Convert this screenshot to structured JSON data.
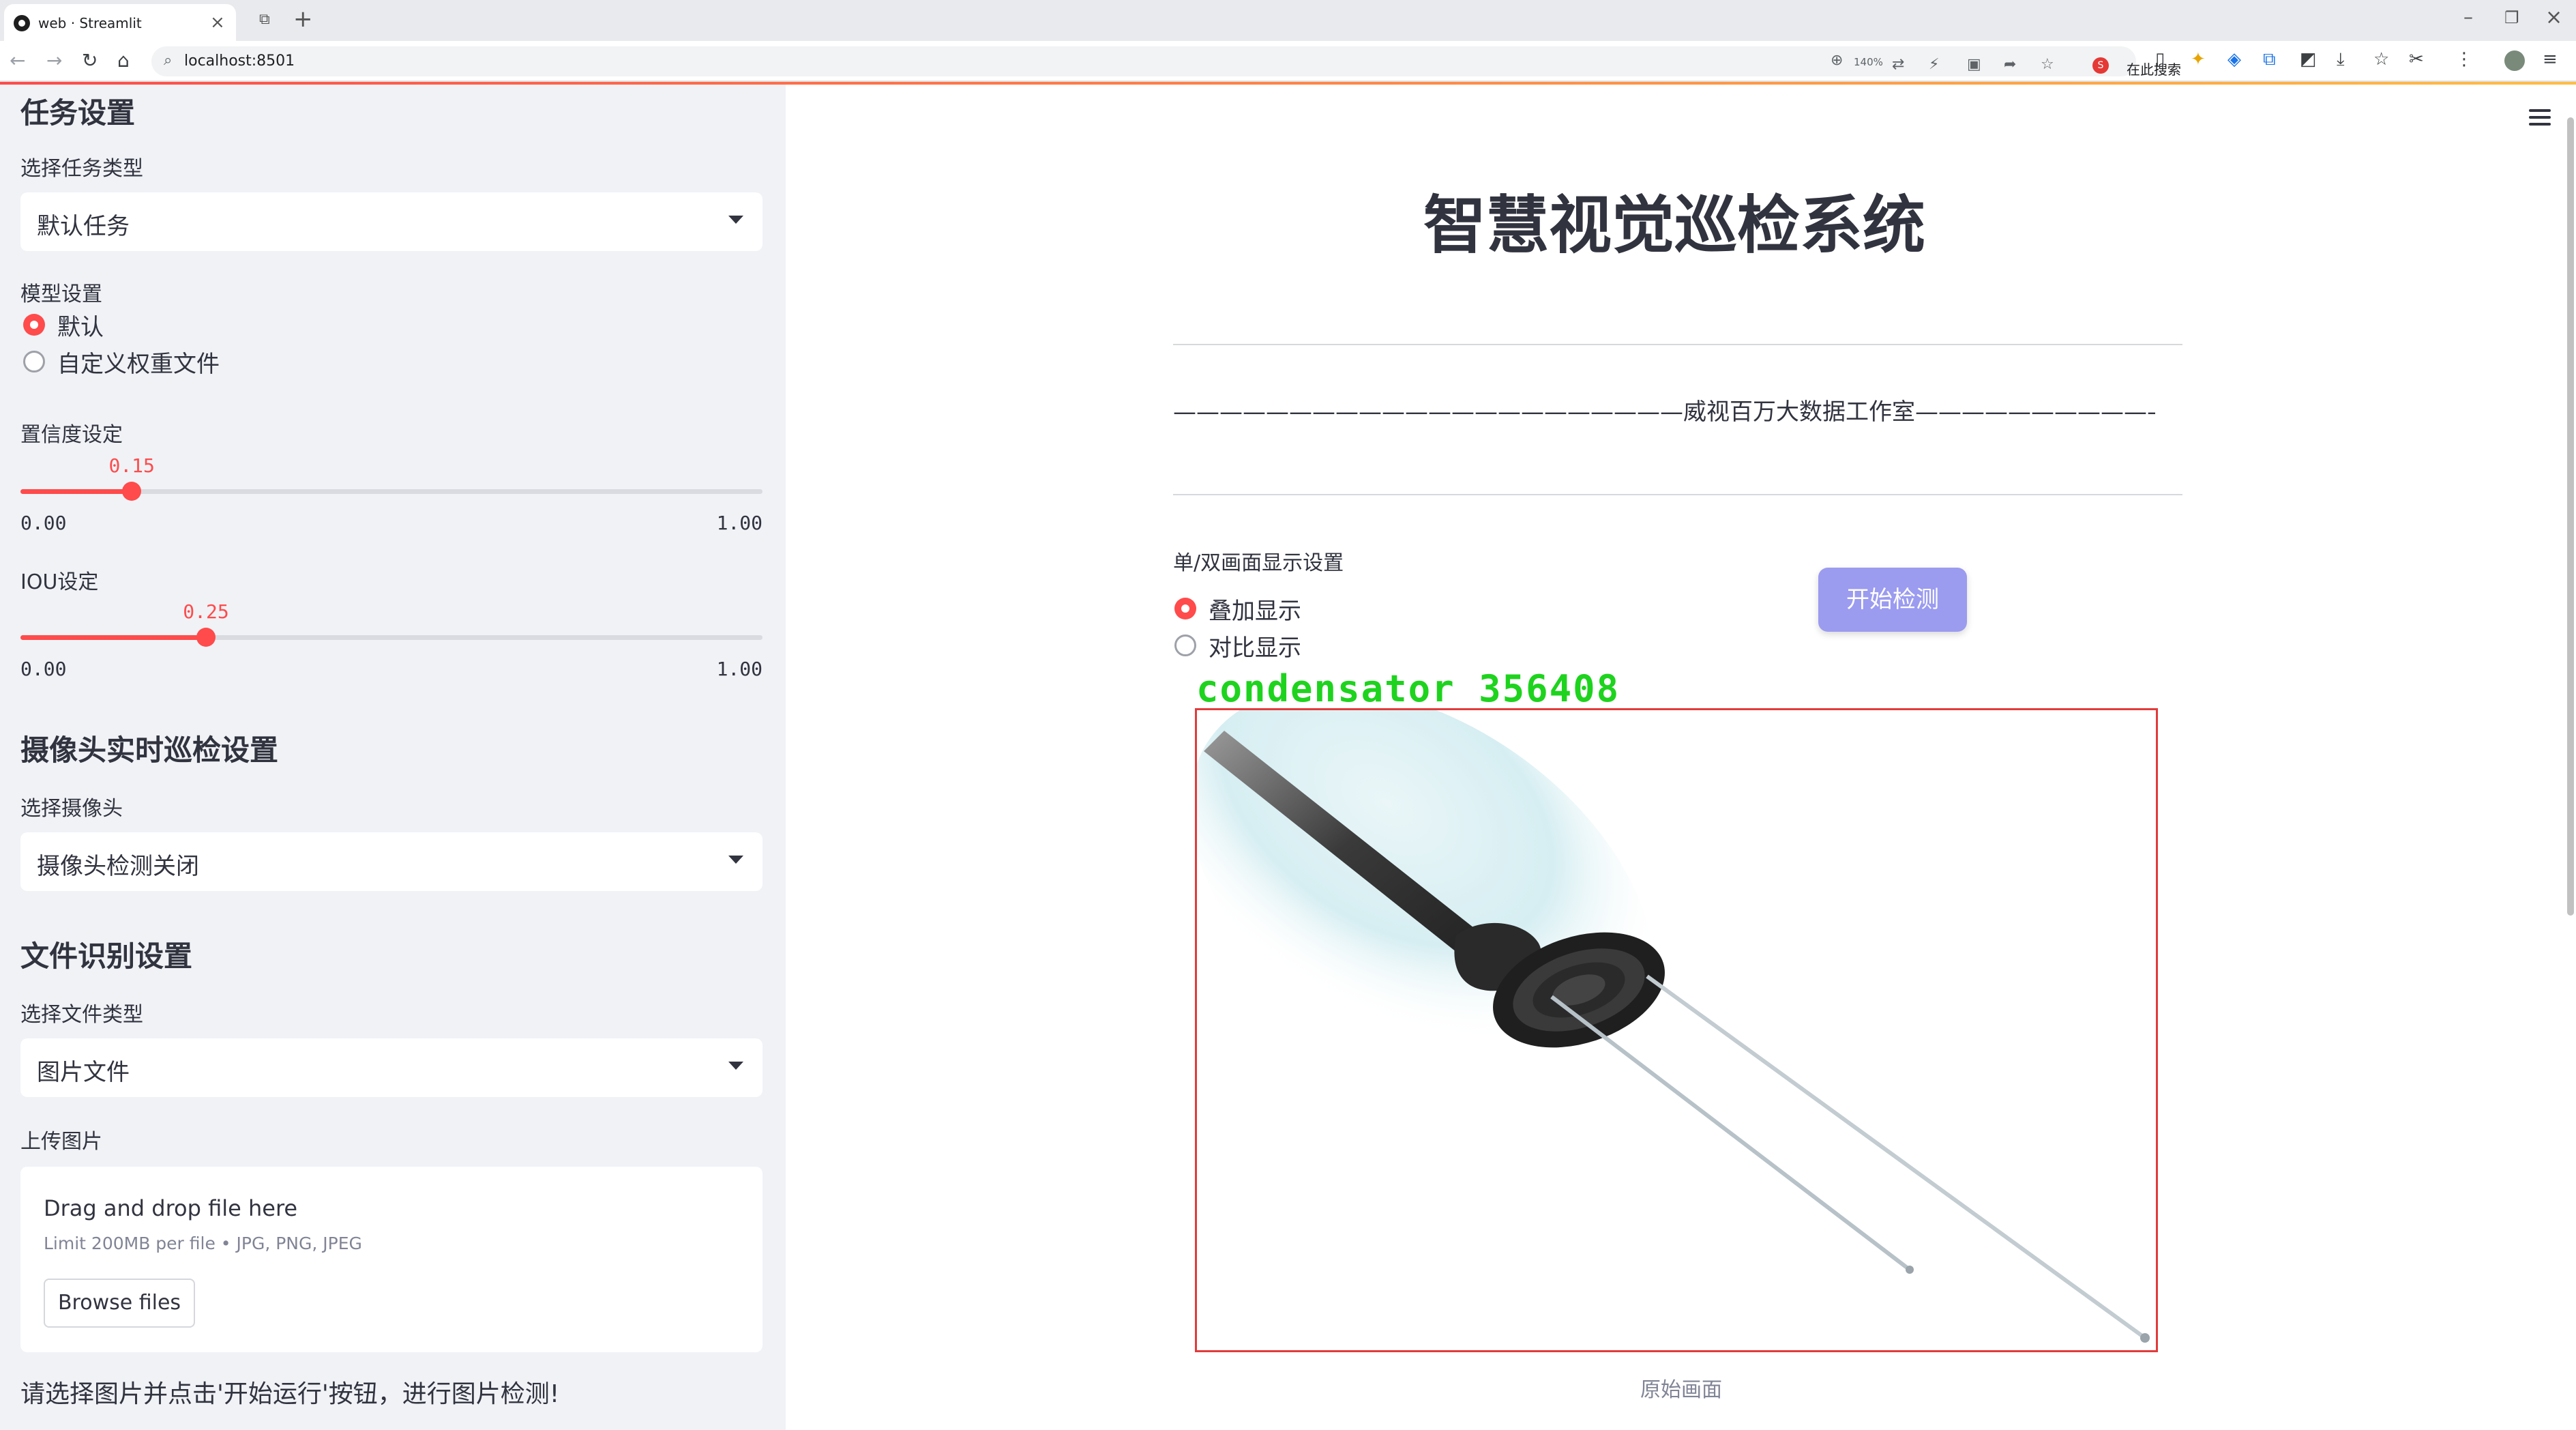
{
  "browser": {
    "tab_title": "web · Streamlit",
    "url": "localhost:8501",
    "zoom": "140%",
    "search_placeholder": "在此搜索"
  },
  "sidebar": {
    "task_header": "任务设置",
    "task_type_label": "选择任务类型",
    "task_type_value": "默认任务",
    "model_label": "模型设置",
    "model_options": [
      "默认",
      "自定义权重文件"
    ],
    "model_selected": "默认",
    "confidence_label": "置信度设定",
    "confidence_value": "0.15",
    "confidence_fraction": 0.15,
    "confidence_min": "0.00",
    "confidence_max": "1.00",
    "iou_label": "IOU设定",
    "iou_value": "0.25",
    "iou_fraction": 0.25,
    "iou_min": "0.00",
    "iou_max": "1.00",
    "camera_header": "摄像头实时巡检设置",
    "camera_label": "选择摄像头",
    "camera_value": "摄像头检测关闭",
    "file_header": "文件识别设置",
    "file_type_label": "选择文件类型",
    "file_type_value": "图片文件",
    "upload_label": "上传图片",
    "upload_drag": "Drag and drop file here",
    "upload_limit": "Limit 200MB per file • JPG, PNG, JPEG",
    "browse_button": "Browse files",
    "hint": "请选择图片并点击'开始运行'按钮，进行图片检测!"
  },
  "main": {
    "title": "智慧视觉巡检系统",
    "subtitle": "——————————————————————威视百万大数据工作室————————————————————————",
    "display_label": "单/双画面显示设置",
    "display_options": [
      "叠加显示",
      "对比显示"
    ],
    "display_selected": "叠加显示",
    "start_button": "开始检测",
    "detection_label": "condensator  356408",
    "caption": "原始画面"
  },
  "colors": {
    "accent": "#ff4b4b",
    "button": "#9b9bf0",
    "detection_box": "#e23b3b",
    "detection_text": "#1ed31e"
  }
}
